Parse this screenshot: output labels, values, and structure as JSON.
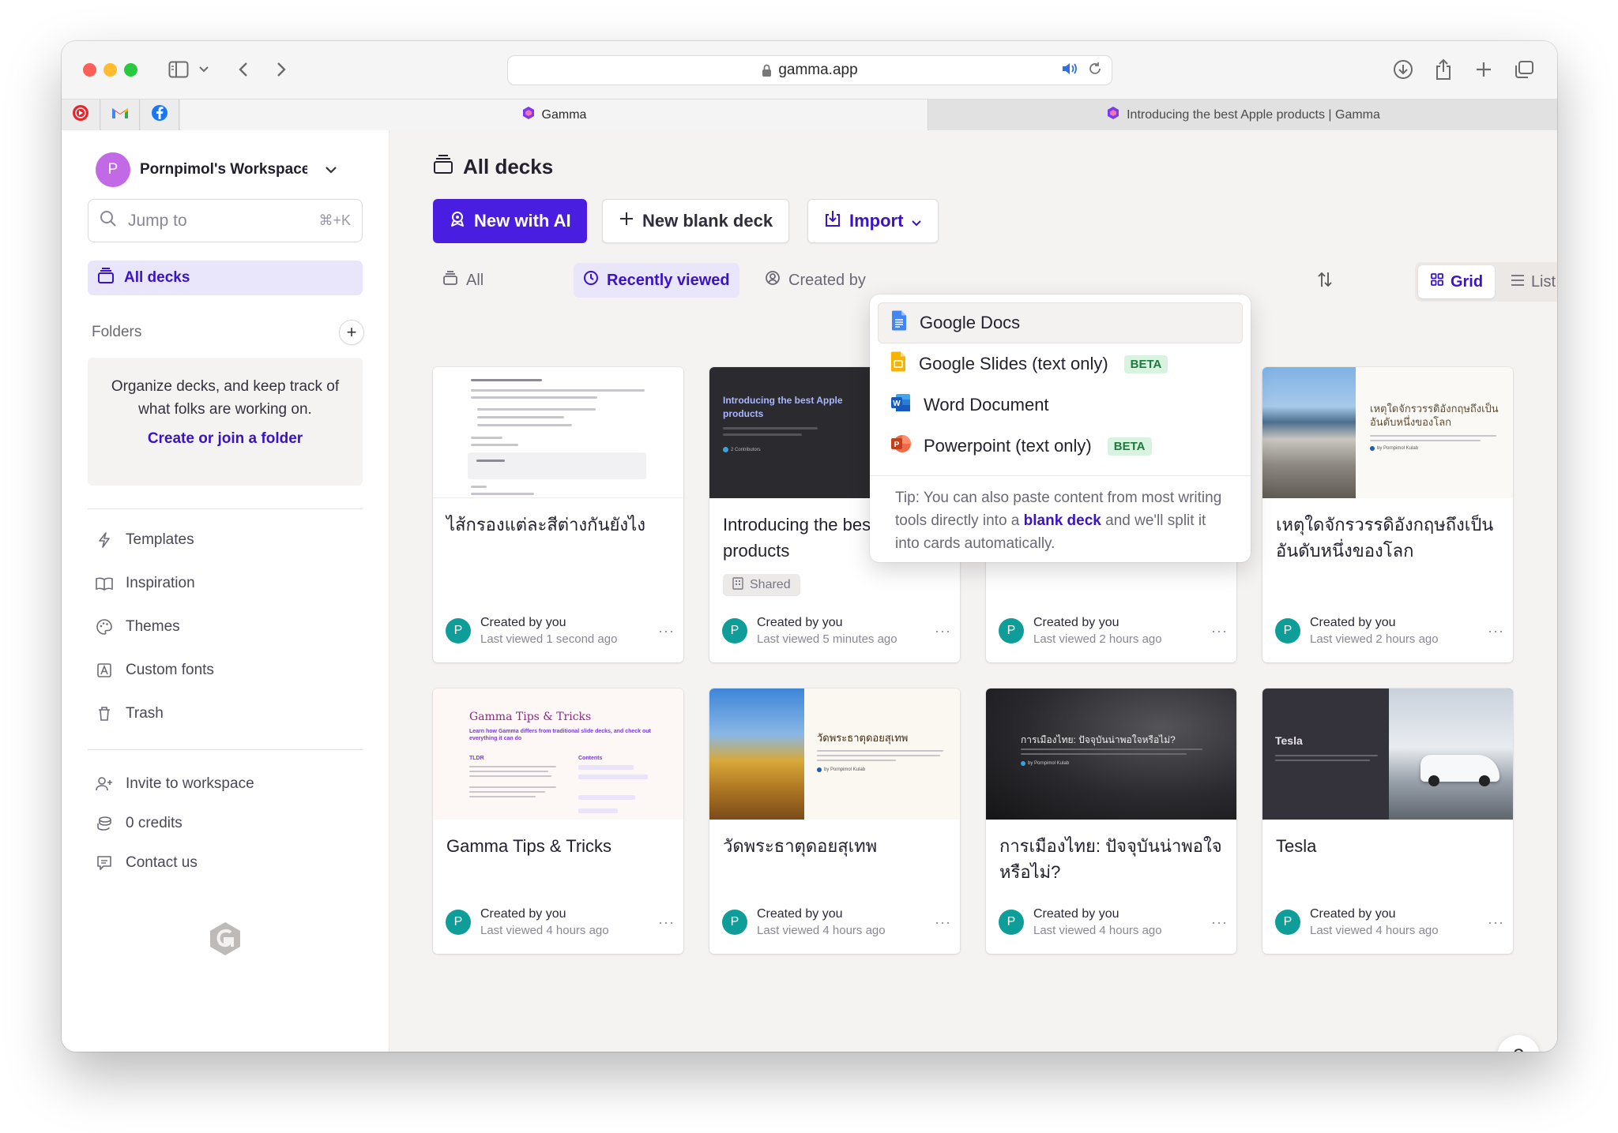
{
  "browser": {
    "url": "gamma.app",
    "tabs": [
      {
        "label": "Gamma"
      },
      {
        "label": "Introducing the best Apple products | Gamma"
      }
    ],
    "pinned": [
      "youtube-icon",
      "gmail-icon",
      "facebook-icon"
    ]
  },
  "sidebar": {
    "workspace_initial": "P",
    "workspace_name": "Pornpimol's Workspace",
    "jump_placeholder": "Jump to",
    "jump_shortcut": "⌘+K",
    "all_decks": "All decks",
    "folders_label": "Folders",
    "folders_empty": "Organize decks, and keep track of what folks are working on.",
    "folders_link": "Create or join a folder",
    "nav": [
      {
        "label": "Templates",
        "icon": "lightning-icon"
      },
      {
        "label": "Inspiration",
        "icon": "book-icon"
      },
      {
        "label": "Themes",
        "icon": "palette-icon"
      },
      {
        "label": "Custom fonts",
        "icon": "font-icon"
      },
      {
        "label": "Trash",
        "icon": "trash-icon"
      }
    ],
    "nav2": [
      {
        "label": "Invite to workspace",
        "icon": "add-user-icon"
      },
      {
        "label": "0 credits",
        "icon": "coins-icon"
      },
      {
        "label": "Contact us",
        "icon": "chat-icon"
      }
    ]
  },
  "main": {
    "title": "All decks",
    "new_ai": "New with AI",
    "new_blank": "New blank deck",
    "import": "Import",
    "filters": {
      "all": "All",
      "recent": "Recently viewed",
      "created": "Created by"
    },
    "view": {
      "grid": "Grid",
      "list": "List"
    }
  },
  "import_menu": {
    "items": [
      {
        "label": "Google Docs",
        "beta": ""
      },
      {
        "label": "Google Slides (text only)",
        "beta": "BETA"
      },
      {
        "label": "Word Document",
        "beta": ""
      },
      {
        "label": "Powerpoint (text only)",
        "beta": "BETA"
      }
    ],
    "tip_before": "Tip: You can also paste content from most writing tools directly into a ",
    "tip_link": "blank deck",
    "tip_after": " and we'll split it into cards automatically."
  },
  "cards": [
    {
      "title": "ไส้กรองแต่ละสีต่างกันยังไง",
      "by": "Created by you",
      "when": "Last viewed 1 second ago"
    },
    {
      "title": "Introducing the best Apple products",
      "by": "Created by you",
      "when": "Last viewed 5 minutes ago",
      "shared": "Shared",
      "thumb_title": "Introducing the best Apple products",
      "thumb_sub": "2 Contributors"
    },
    {
      "title": "",
      "by": "Created by you",
      "when": "Last viewed 2 hours ago"
    },
    {
      "title": "เหตุใดจักรวรรดิอังกฤษถึงเป็นอันดับหนึ่งของโลก",
      "by": "Created by you",
      "when": "Last viewed 2 hours ago",
      "thumb_title": "เหตุใดจักรวรรดิอังกฤษถึงเป็นอันดับหนึ่งของโลก",
      "thumb_sub": "by Pornpimol Kulab"
    },
    {
      "title": "Gamma Tips & Tricks",
      "by": "Created by you",
      "when": "Last viewed 4 hours ago",
      "thumb_title": "Gamma Tips & Tricks",
      "thumb_sub": "Learn how Gamma differs from traditional slide decks, and check out everything it can do",
      "thumb_tldr": "TLDR",
      "thumb_contents": "Contents"
    },
    {
      "title": "วัดพระธาตุดอยสุเทพ",
      "by": "Created by you",
      "when": "Last viewed 4 hours ago",
      "thumb_title": "วัดพระธาตุดอยสุเทพ",
      "thumb_sub": "by Pornpimol Kulab"
    },
    {
      "title": "การเมืองไทย: ปัจจุบันน่าพอใจหรือไม่?",
      "by": "Created by you",
      "when": "Last viewed 4 hours ago",
      "thumb_title": "การเมืองไทย: ปัจจุบันน่าพอใจหรือไม่?",
      "thumb_sub": "by Pornpimol Kulab"
    },
    {
      "title": "Tesla",
      "by": "Created by you",
      "when": "Last viewed 4 hours ago",
      "thumb_title": "Tesla"
    }
  ],
  "card_avatar": "P",
  "help": "?"
}
